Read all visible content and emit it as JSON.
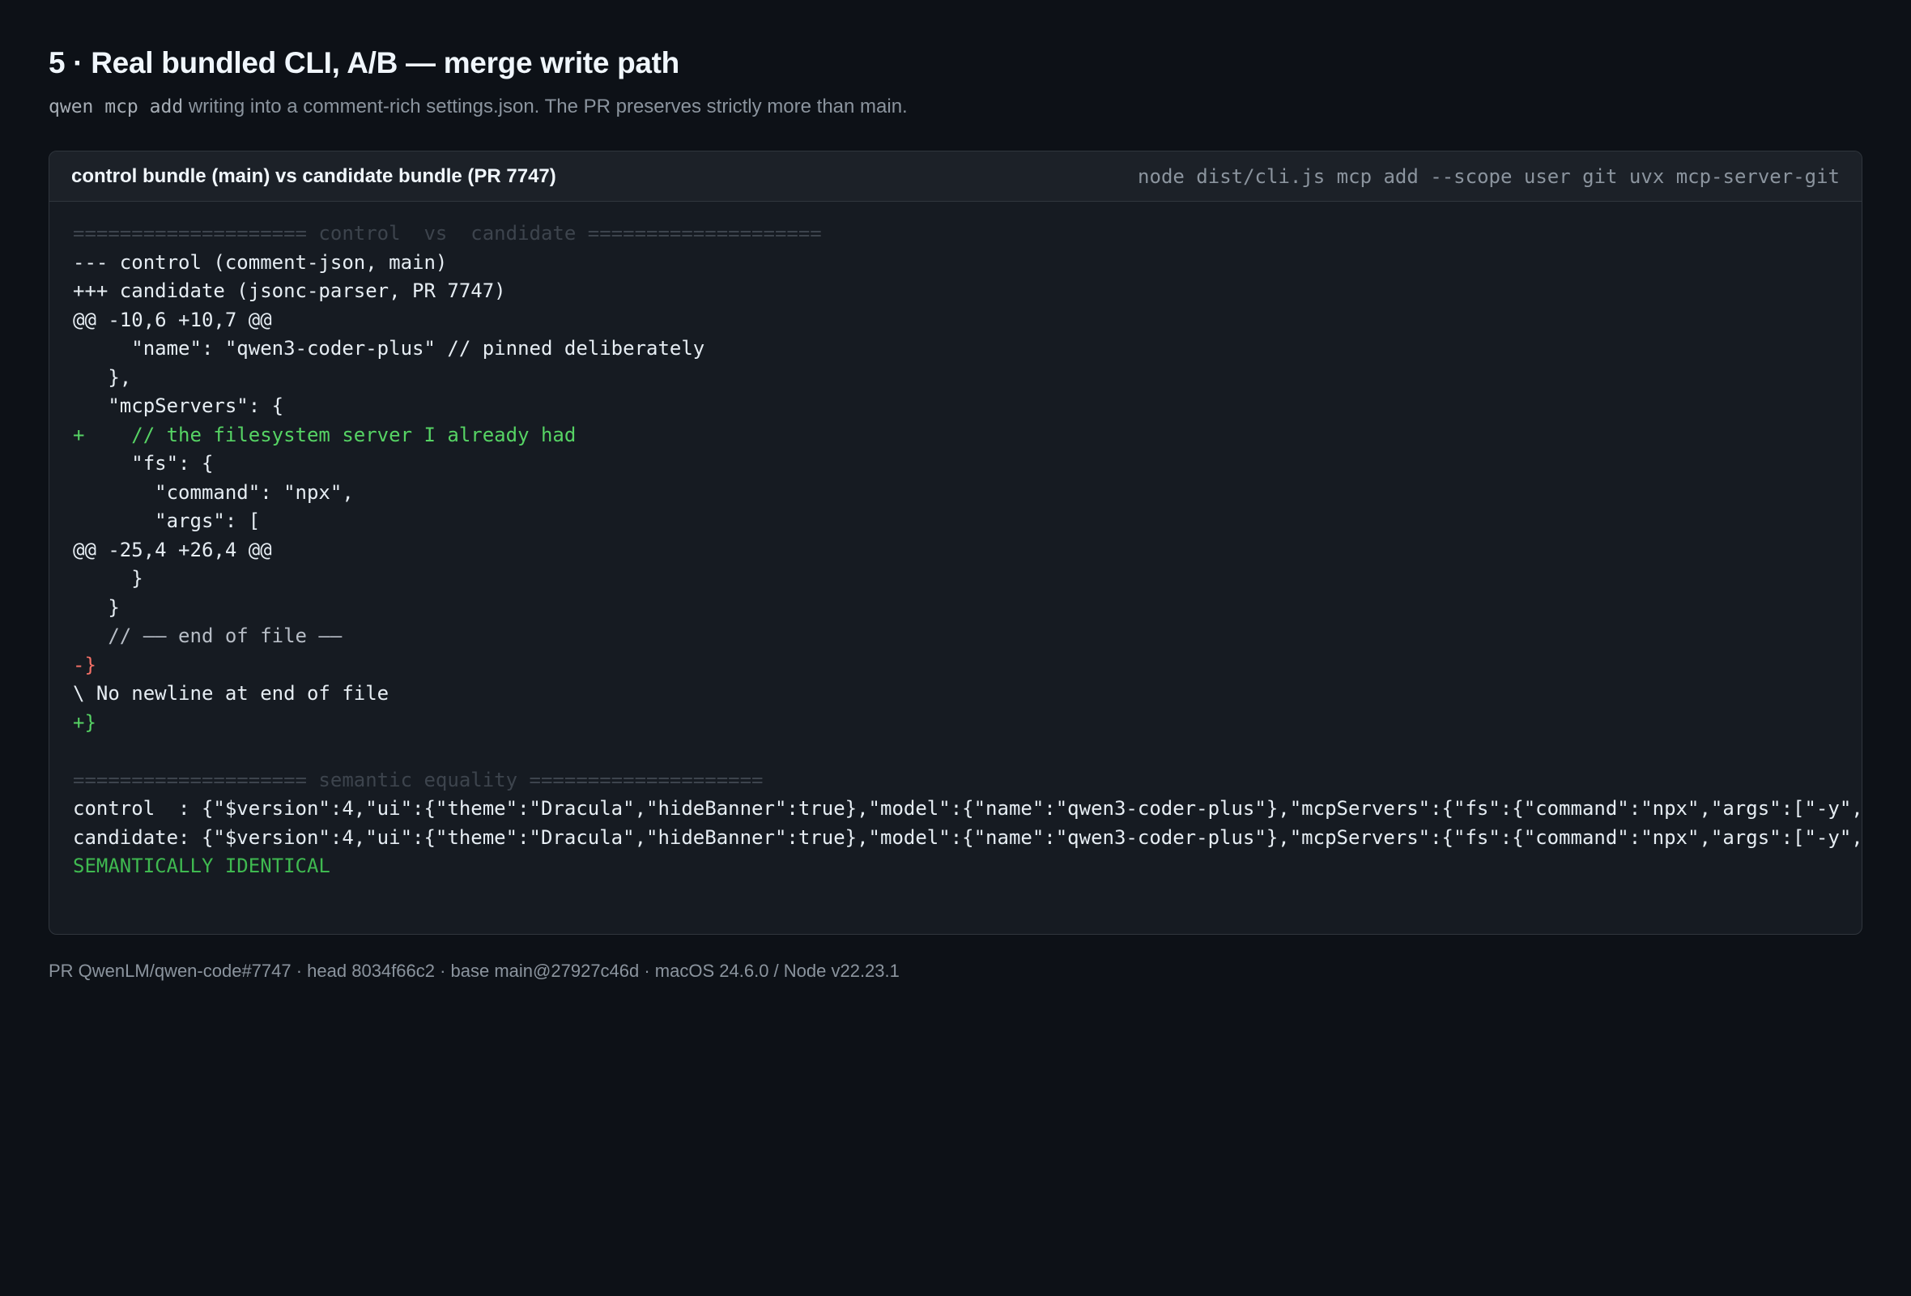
{
  "header": {
    "title": "5 · Real bundled CLI, A/B — merge write path",
    "subtitle_code": "qwen mcp add",
    "subtitle_text": " writing into a comment-rich settings.json. The PR preserves strictly more than main."
  },
  "panel": {
    "title": "control bundle (main) vs candidate bundle (PR 7747)",
    "command": "node dist/cli.js mcp add --scope user git uvx mcp-server-git",
    "lines": {
      "sep1": "==================== control  vs  candidate ====================",
      "l1": "--- control (comment-json, main)",
      "l2": "+++ candidate (jsonc-parser, PR 7747)",
      "l3": "@@ -10,6 +10,7 @@",
      "l4": "     \"name\": \"qwen3-coder-plus\" // pinned deliberately",
      "l5": "   },",
      "l6": "   \"mcpServers\": {",
      "l7": "+    // the filesystem server I already had",
      "l8": "     \"fs\": {",
      "l9": "       \"command\": \"npx\",",
      "l10": "       \"args\": [",
      "l11": "@@ -25,4 +26,4 @@",
      "l12": "     }",
      "l13": "   }",
      "l14": "   // —— end of file ——",
      "l15": "-}",
      "l16": "\\ No newline at end of file",
      "l17": "+}",
      "sep2": "==================== semantic equality ====================",
      "l18": "control  : {\"$version\":4,\"ui\":{\"theme\":\"Dracula\",\"hideBanner\":true},\"model\":{\"name\":\"qwen3-coder-plus\"},\"mcpServers\":{\"fs\":{\"command\":\"npx\",\"args\":[\"-y\",",
      "l19": "candidate: {\"$version\":4,\"ui\":{\"theme\":\"Dracula\",\"hideBanner\":true},\"model\":{\"name\":\"qwen3-coder-plus\"},\"mcpServers\":{\"fs\":{\"command\":\"npx\",\"args\":[\"-y\",",
      "l20": "SEMANTICALLY IDENTICAL"
    }
  },
  "footer": {
    "text": "PR QwenLM/qwen-code#7747  ·  head 8034f66c2  ·  base main@27927c46d  ·  macOS 24.6.0 / Node v22.23.1"
  },
  "colors": {
    "background": "#0d1117",
    "added": "#56d364",
    "removed": "#f47067",
    "ok": "#3fb950"
  }
}
